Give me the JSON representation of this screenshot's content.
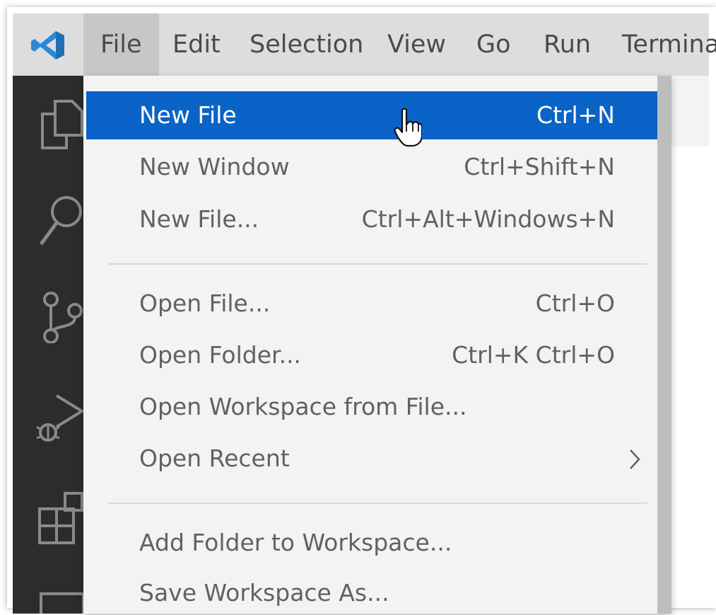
{
  "menubar": {
    "items": [
      {
        "label": "File",
        "active": true
      },
      {
        "label": "Edit"
      },
      {
        "label": "Selection"
      },
      {
        "label": "View"
      },
      {
        "label": "Go"
      },
      {
        "label": "Run"
      },
      {
        "label": "Termina"
      }
    ]
  },
  "file_menu": {
    "groups": [
      [
        {
          "label": "New File",
          "shortcut": "Ctrl+N",
          "selected": true
        },
        {
          "label": "New Window",
          "shortcut": "Ctrl+Shift+N"
        },
        {
          "label": "New File...",
          "shortcut": "Ctrl+Alt+Windows+N"
        }
      ],
      [
        {
          "label": "Open File...",
          "shortcut": "Ctrl+O"
        },
        {
          "label": "Open Folder...",
          "shortcut": "Ctrl+K Ctrl+O"
        },
        {
          "label": "Open Workspace from File...",
          "shortcut": ""
        },
        {
          "label": "Open Recent",
          "shortcut": "",
          "submenu": true
        }
      ],
      [
        {
          "label": "Add Folder to Workspace...",
          "shortcut": ""
        },
        {
          "label": "Save Workspace As...",
          "shortcut": ""
        }
      ]
    ]
  },
  "activity_icons": [
    "explorer-icon",
    "search-icon",
    "source-control-icon",
    "run-debug-icon",
    "extensions-icon",
    "remote-icon"
  ],
  "colors": {
    "selection": "#0a63c7",
    "menu_bg": "#f3f3f3",
    "titlebar_bg": "#dddddd",
    "activitybar_bg": "#2c2c2c",
    "logo": "#2a89d8"
  }
}
